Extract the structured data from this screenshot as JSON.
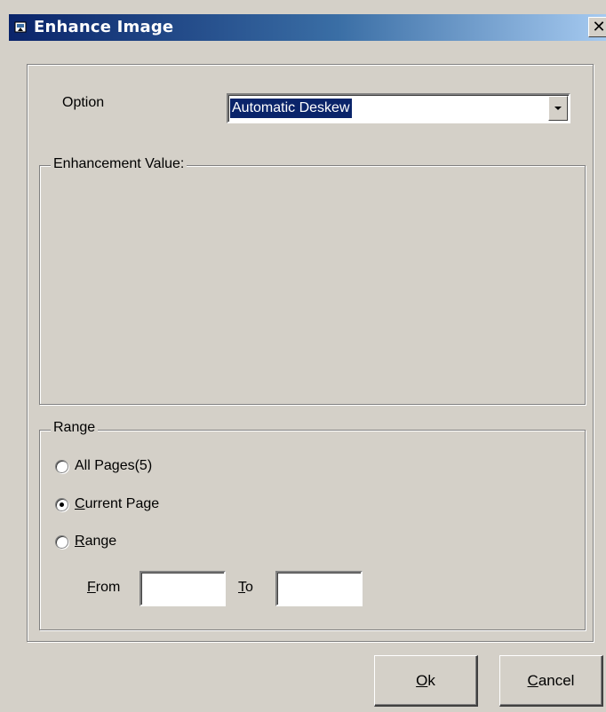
{
  "window": {
    "title": "Enhance Image",
    "close_glyph": "✕",
    "icon": "image-icon"
  },
  "option": {
    "label": "Option",
    "selected": "Automatic Deskew"
  },
  "enhancement": {
    "title": "Enhancement Value:"
  },
  "range": {
    "title": "Range",
    "all_pages": "All Pages(5)",
    "current_page": {
      "key": "C",
      "rest": "urrent Page"
    },
    "range_option": {
      "key": "R",
      "rest": "ange"
    },
    "from": {
      "key": "F",
      "rest": "rom",
      "value": ""
    },
    "to": {
      "key": "T",
      "rest": "o",
      "value": ""
    },
    "selected": "current_page"
  },
  "buttons": {
    "ok": {
      "key": "O",
      "rest": "k"
    },
    "cancel": {
      "key": "C",
      "rest": "ancel"
    }
  },
  "colors": {
    "face": "#d4d0c8",
    "title_start": "#0a246a",
    "title_end": "#a6caf0",
    "selection": "#0a246a"
  }
}
